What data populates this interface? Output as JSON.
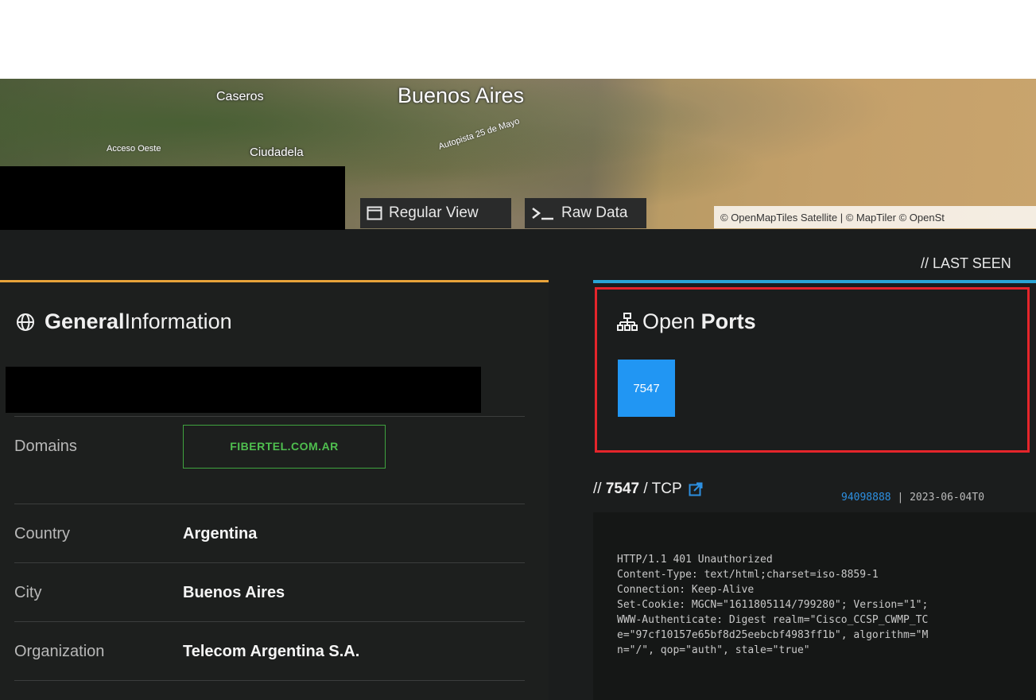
{
  "map": {
    "labels": {
      "caseros": "Caseros",
      "buenos_aires": "Buenos Aires",
      "acceso_oeste": "Acceso Oeste",
      "ciudadela": "Ciudadela",
      "autopista": "Autopista 25 de Mayo"
    },
    "buttons": {
      "regular_view": "Regular View",
      "raw_data": "Raw Data"
    },
    "attribution": "© OpenMapTiles Satellite | © MapTiler © OpenSt"
  },
  "last_seen_label": "// LAST SEEN",
  "general": {
    "title_bold": "General",
    "title_rest": " Information",
    "rows": [
      {
        "label": "Domains",
        "value": "FIBERTEL.COM.AR"
      },
      {
        "label": "Country",
        "value": "Argentina"
      },
      {
        "label": "City",
        "value": "Buenos Aires"
      },
      {
        "label": "Organization",
        "value": "Telecom Argentina S.A."
      }
    ]
  },
  "ports": {
    "title_rest": "Open ",
    "title_bold": "Ports",
    "list": [
      "7547"
    ]
  },
  "service": {
    "prefix": "// ",
    "port": "7547",
    "proto": " / TCP",
    "hash": "94098888",
    "separator": " | ",
    "timestamp": "2023-06-04T0",
    "banner": "HTTP/1.1 401 Unauthorized\nContent-Type: text/html;charset=iso-8859-1\nConnection: Keep-Alive\nSet-Cookie: MGCN=\"1611805114/799280\"; Version=\"1\";\nWWW-Authenticate: Digest realm=\"Cisco_CCSP_CWMP_TC\ne=\"97cf10157e65bf8d25eebcbf4983ff1b\", algorithm=\"M\nn=\"/\", qop=\"auth\", stale=\"true\""
  },
  "colors": {
    "accent_orange": "#e8a33a",
    "accent_blue": "#29a5d5",
    "port_chip": "#2196f3",
    "domain_green": "#4fbf4f",
    "highlight_red": "#e5252b"
  }
}
